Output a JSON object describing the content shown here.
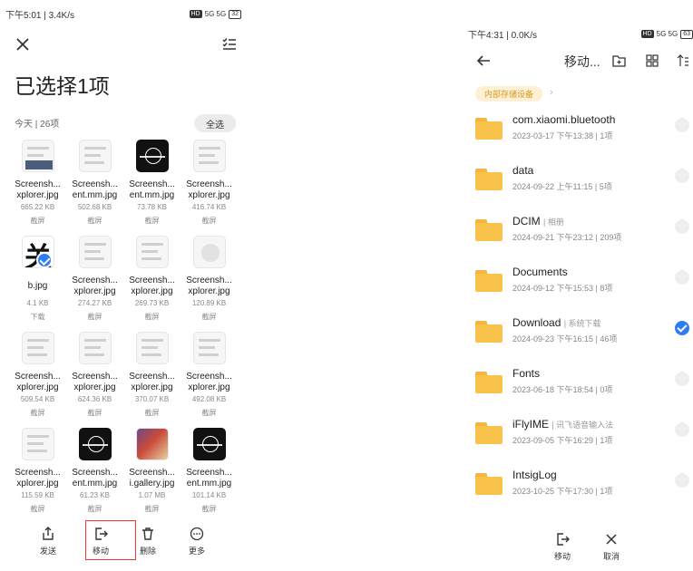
{
  "left": {
    "status": {
      "time": "下午5:01 | 3.4K/s",
      "hd": "HD",
      "signal": "5G 5G",
      "battery": "32"
    },
    "title": "已选择1项",
    "today": "今天",
    "count": "26项",
    "select_all": "全选",
    "files": [
      {
        "line1": "Screensh...",
        "line2": "xplorer.jpg",
        "size": "665.22 KB",
        "source": "截屏",
        "thumb": "shot"
      },
      {
        "line1": "Screensh...",
        "line2": "ent.mm.jpg",
        "size": "502.68 KB",
        "source": "截屏",
        "thumb": "light"
      },
      {
        "line1": "Screensh...",
        "line2": "ent.mm.jpg",
        "size": "73.78 KB",
        "source": "截屏",
        "thumb": "dark"
      },
      {
        "line1": "Screensh...",
        "line2": "xplorer.jpg",
        "size": "416.74 KB",
        "source": "截屏",
        "thumb": "light"
      },
      {
        "line1": "b.jpg",
        "line2": "",
        "size": "4.1 KB",
        "source": "下载",
        "thumb": "glyph",
        "glyph": "关",
        "selected": true
      },
      {
        "line1": "Screensh...",
        "line2": "xplorer.jpg",
        "size": "274.27 KB",
        "source": "截屏",
        "thumb": "light"
      },
      {
        "line1": "Screensh...",
        "line2": "xplorer.jpg",
        "size": "269.73 KB",
        "source": "截屏",
        "thumb": "light"
      },
      {
        "line1": "Screensh...",
        "line2": "xplorer.jpg",
        "size": "120.89 KB",
        "source": "截屏",
        "thumb": "dot"
      },
      {
        "line1": "Screensh...",
        "line2": "xplorer.jpg",
        "size": "509.54 KB",
        "source": "截屏",
        "thumb": "light"
      },
      {
        "line1": "Screensh...",
        "line2": "xplorer.jpg",
        "size": "624.36 KB",
        "source": "截屏",
        "thumb": "light"
      },
      {
        "line1": "Screensh...",
        "line2": "xplorer.jpg",
        "size": "370.07 KB",
        "source": "截屏",
        "thumb": "light"
      },
      {
        "line1": "Screensh...",
        "line2": "xplorer.jpg",
        "size": "492.08 KB",
        "source": "截屏",
        "thumb": "light"
      },
      {
        "line1": "Screensh...",
        "line2": "xplorer.jpg",
        "size": "115.59 KB",
        "source": "截屏",
        "thumb": "light"
      },
      {
        "line1": "Screensh...",
        "line2": "ent.mm.jpg",
        "size": "61.23 KB",
        "source": "截屏",
        "thumb": "dark"
      },
      {
        "line1": "Screensh...",
        "line2": "i.gallery.jpg",
        "size": "1.07 MB",
        "source": "截屏",
        "thumb": "gal"
      },
      {
        "line1": "Screensh...",
        "line2": "ent.mm.jpg",
        "size": "101.14 KB",
        "source": "截屏",
        "thumb": "dark"
      }
    ],
    "actions": {
      "send": "发送",
      "move": "移动",
      "delete": "删除",
      "more": "更多"
    }
  },
  "right": {
    "status": {
      "time": "下午4:31 | 0.0K/s",
      "hd": "HD",
      "signal": "5G 5G",
      "battery": "63"
    },
    "title": "移动...",
    "crumb": "内部存储设备",
    "folders": [
      {
        "name": "com.xiaomi.bluetooth",
        "tag": "",
        "meta": "2023-03-17 下午13:38 | 1项",
        "selected": false
      },
      {
        "name": "data",
        "tag": "",
        "meta": "2024-09-22 上午11:15 | 5项",
        "selected": false
      },
      {
        "name": "DCIM",
        "tag": "| 相册",
        "meta": "2024-09-21 下午23:12 | 209项",
        "selected": false
      },
      {
        "name": "Documents",
        "tag": "",
        "meta": "2024-09-12 下午15:53 | 8项",
        "selected": false
      },
      {
        "name": "Download",
        "tag": "| 系统下载",
        "meta": "2024-09-23 下午16:15 | 46项",
        "selected": true
      },
      {
        "name": "Fonts",
        "tag": "",
        "meta": "2023-06-18 下午18:54 | 0项",
        "selected": false
      },
      {
        "name": "iFlyIME",
        "tag": "| 讯飞语音输入法",
        "meta": "2023-09-05 下午16:29 | 1项",
        "selected": false
      },
      {
        "name": "IntsigLog",
        "tag": "",
        "meta": "2023-10-25 下午17:30 | 1项",
        "selected": false
      }
    ],
    "actions": {
      "move": "移动",
      "cancel": "取消"
    }
  },
  "colors": {
    "accent": "#2f7df6",
    "folder": "#f9c24a",
    "highlight": "#e53935",
    "crumb_bg": "#fdf0d4",
    "crumb_text": "#d49a20"
  }
}
